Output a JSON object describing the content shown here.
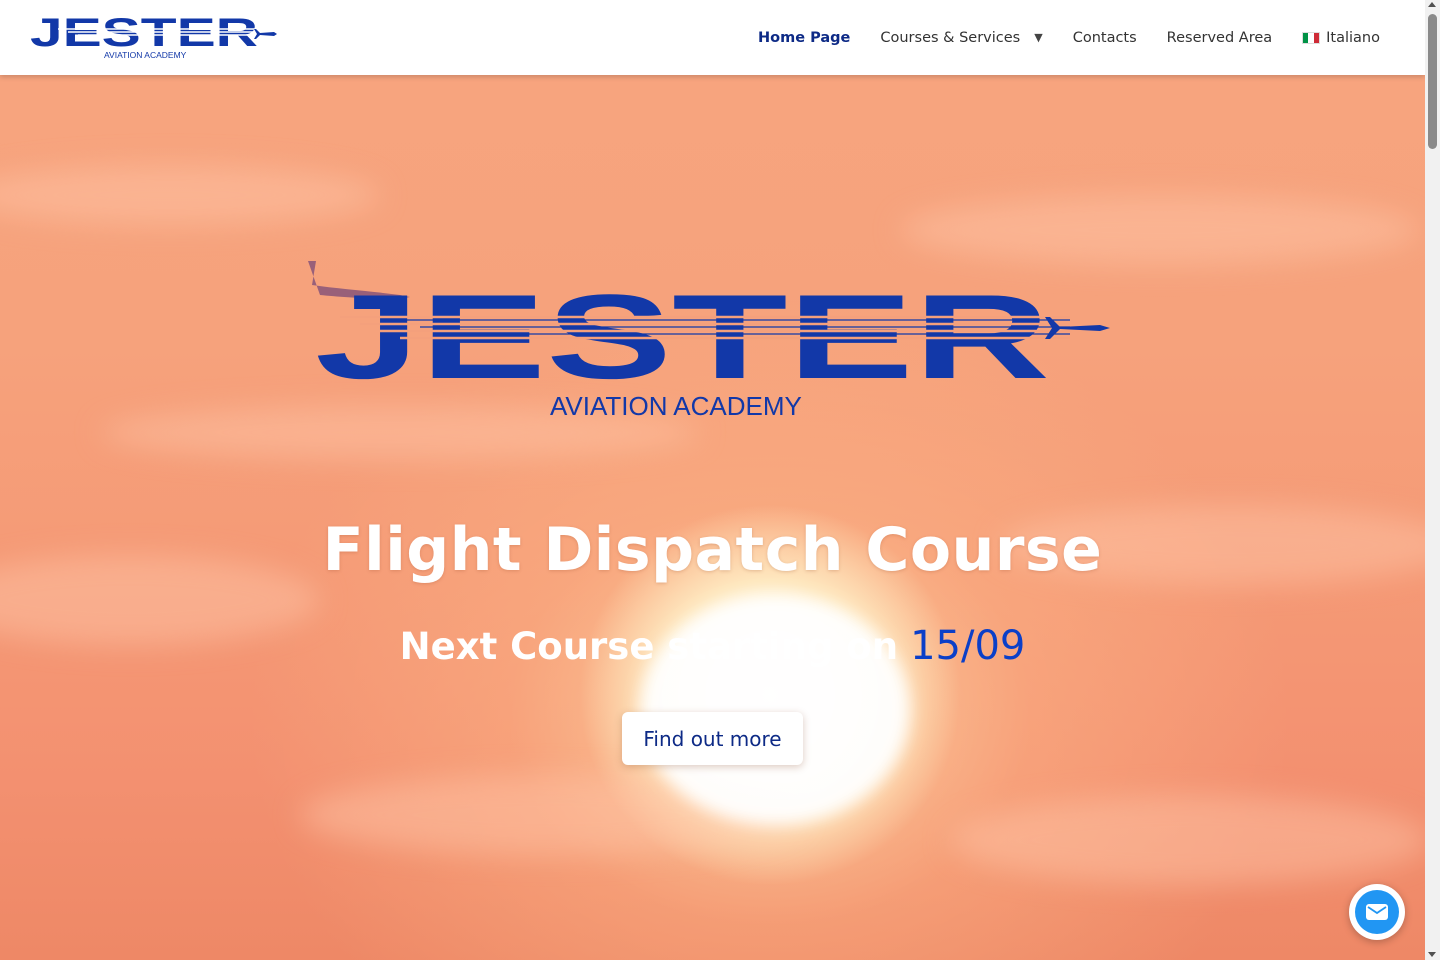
{
  "header": {
    "logo": {
      "wordmark": "JESTER",
      "tagline": "AVIATION ACADEMY"
    },
    "nav": [
      {
        "label": "Home Page",
        "active": true
      },
      {
        "label": "Courses & Services",
        "has_dropdown": true
      },
      {
        "label": "Contacts"
      },
      {
        "label": "Reserved Area"
      },
      {
        "label": "Italiano",
        "icon": "italian-flag-icon"
      }
    ]
  },
  "hero": {
    "logo": {
      "wordmark": "JESTER",
      "tagline": "AVIATION ACADEMY"
    },
    "title": "Flight Dispatch Course",
    "subtitle_prefix": "Next Course starting on",
    "subtitle_date": "15/09",
    "cta_label": "Find out more"
  },
  "chat": {
    "icon": "mail-icon"
  },
  "colors": {
    "brand_blue": "#1238a8",
    "accent_date_blue": "#0b3fc8",
    "chat_blue": "#2196f3",
    "sky_orange": "#f6a27c"
  }
}
